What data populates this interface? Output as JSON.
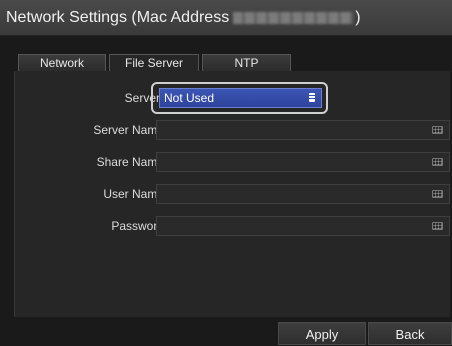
{
  "window": {
    "title_prefix": "Network Settings (Mac Address",
    "title_suffix": ")"
  },
  "tabs": [
    {
      "label": "Network",
      "active": false
    },
    {
      "label": "File Server",
      "active": true
    },
    {
      "label": "NTP",
      "active": false
    }
  ],
  "form": {
    "server": {
      "label": "Server",
      "value": "Not Used"
    },
    "server_name": {
      "label": "Server Name",
      "value": ""
    },
    "share_name": {
      "label": "Share Name",
      "value": ""
    },
    "user_name": {
      "label": "User Name",
      "value": ""
    },
    "password": {
      "label": "Password",
      "value": ""
    }
  },
  "buttons": {
    "apply": "Apply",
    "back": "Back"
  },
  "colors": {
    "select_accent": "#3349a8",
    "focus_ring": "#cfcfcf"
  }
}
